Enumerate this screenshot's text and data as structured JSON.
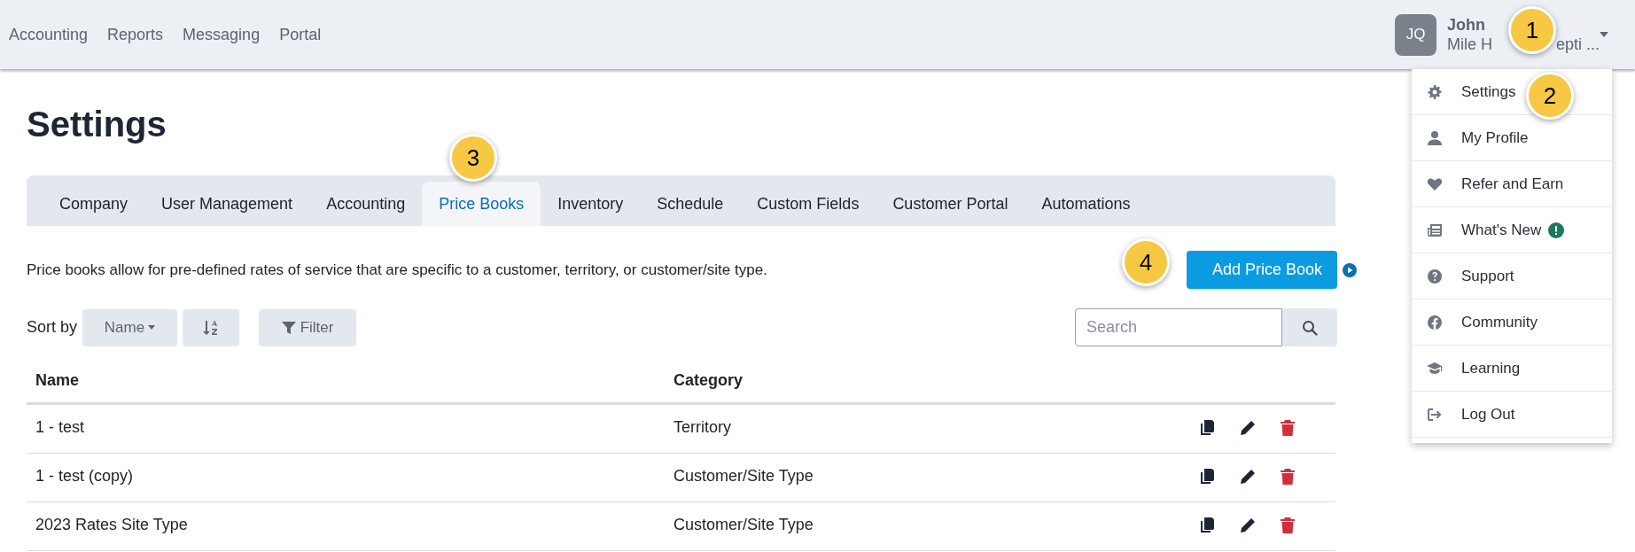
{
  "top_nav": [
    {
      "label": "Accounting"
    },
    {
      "label": "Reports"
    },
    {
      "label": "Messaging"
    },
    {
      "label": "Portal"
    }
  ],
  "user": {
    "initials": "JQ",
    "name": "John",
    "company_visible_start": "Mile H",
    "company_visible_end": "epti ..."
  },
  "user_menu": [
    {
      "label": "Settings",
      "badge": false
    },
    {
      "label": "My Profile",
      "badge": false
    },
    {
      "label": "Refer and Earn",
      "badge": false
    },
    {
      "label": "What's New",
      "badge": true
    },
    {
      "label": "Support",
      "badge": false
    },
    {
      "label": "Community",
      "badge": false
    },
    {
      "label": "Learning",
      "badge": false
    },
    {
      "label": "Log Out",
      "badge": false
    }
  ],
  "page_title": "Settings",
  "tabs": [
    {
      "label": "Company",
      "selected": false
    },
    {
      "label": "User Management",
      "selected": false
    },
    {
      "label": "Accounting",
      "selected": false
    },
    {
      "label": "Price Books",
      "selected": true
    },
    {
      "label": "Inventory",
      "selected": false
    },
    {
      "label": "Schedule",
      "selected": false
    },
    {
      "label": "Custom Fields",
      "selected": false
    },
    {
      "label": "Customer Portal",
      "selected": false
    },
    {
      "label": "Automations",
      "selected": false
    }
  ],
  "description": "Price books allow for pre-defined rates of service that are specific to a customer, territory, or customer/site type.",
  "add_button": "Add Price Book",
  "sort": {
    "label": "Sort by",
    "field": "Name",
    "filter": "Filter"
  },
  "search": {
    "placeholder": "Search"
  },
  "table": {
    "columns": [
      "Name",
      "Category"
    ],
    "rows": [
      {
        "name": "1 - test",
        "category": "Territory"
      },
      {
        "name": "1 - test (copy)",
        "category": "Customer/Site Type"
      },
      {
        "name": "2023 Rates Site Type",
        "category": "Customer/Site Type"
      }
    ]
  },
  "callouts": [
    "1",
    "2",
    "3",
    "4"
  ]
}
